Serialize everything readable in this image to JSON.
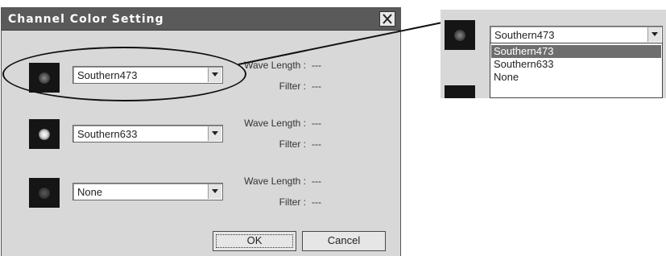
{
  "dialog": {
    "title": "Channel Color Setting",
    "close_icon": "close-x-icon",
    "channels": [
      {
        "selected": "Southern473",
        "wave_label": "Wave Length :",
        "wave_value": "---",
        "filter_label": "Filter :",
        "filter_value": "---"
      },
      {
        "selected": "Southern633",
        "wave_label": "Wave Length :",
        "wave_value": "---",
        "filter_label": "Filter :",
        "filter_value": "---"
      },
      {
        "selected": "None",
        "wave_label": "Wave Length :",
        "wave_value": "---",
        "filter_label": "Filter :",
        "filter_value": "---"
      }
    ],
    "ok_label": "OK",
    "cancel_label": "Cancel"
  },
  "inset": {
    "selected": "Southern473",
    "options": [
      "Southern473",
      "Southern633",
      "None"
    ],
    "highlighted_index": 0
  },
  "colors": {
    "titlebar": "#5a5a5a",
    "dialog_bg": "#d8d8d8",
    "swatch_bg": "#151515",
    "highlight": "#6e6e6e"
  }
}
